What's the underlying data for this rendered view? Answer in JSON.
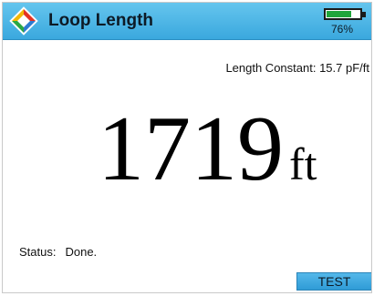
{
  "header": {
    "title": "Loop Length",
    "logo_icon": "diamond-logo-icon",
    "battery": {
      "icon": "battery-icon",
      "level": 0.76,
      "percent_label": "76%",
      "fill_color": "#1fa53a"
    },
    "bar_color": "#3aa8de"
  },
  "main": {
    "length_constant": "Length Constant: 15.7 pF/ft",
    "reading_value": "1719",
    "reading_unit": "ft"
  },
  "status": {
    "label": "Status:",
    "value": "Done."
  },
  "softkeys": {
    "test_label": "TEST"
  }
}
